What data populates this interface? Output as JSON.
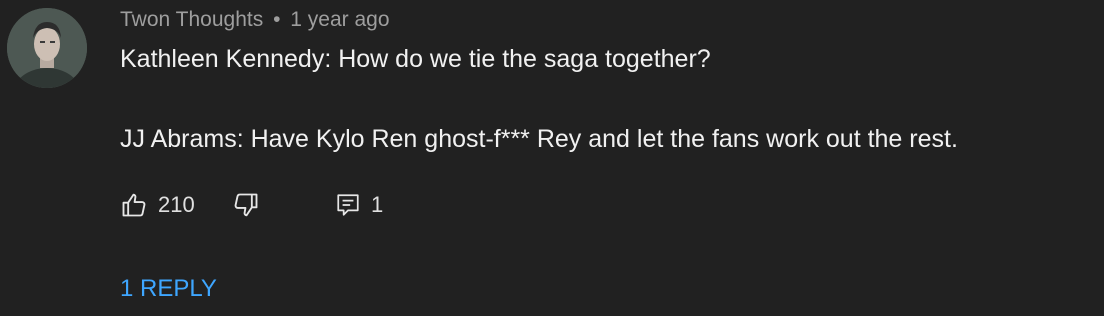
{
  "comment": {
    "author": "Twon Thoughts",
    "separator": "•",
    "time": "1 year ago",
    "lines": [
      "Kathleen Kennedy: How do we tie the saga together?",
      "JJ Abrams: Have Kylo Ren ghost-f*** Rey and let the fans work out the rest."
    ],
    "likes": "210",
    "reply_count": "1",
    "replies_link": "1 REPLY"
  },
  "colors": {
    "background": "#212121",
    "text": "#f1f1f1",
    "meta": "#9e9e9e",
    "link": "#3ea6ff"
  },
  "icons": {
    "like": "thumbs-up-icon",
    "dislike": "thumbs-down-icon",
    "reply": "comment-icon"
  }
}
